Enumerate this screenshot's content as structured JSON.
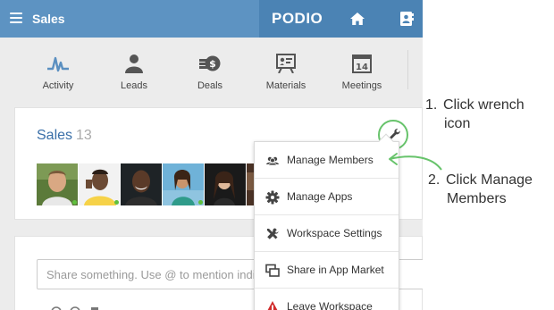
{
  "topbar": {
    "app_title": "Sales",
    "logo": "PODIO",
    "icons": [
      "menu-icon",
      "home-icon",
      "contacts-icon"
    ]
  },
  "nav": {
    "items": [
      {
        "label": "Activity",
        "icon": "activity-icon"
      },
      {
        "label": "Leads",
        "icon": "person-icon"
      },
      {
        "label": "Deals",
        "icon": "money-icon"
      },
      {
        "label": "Materials",
        "icon": "presentation-icon"
      },
      {
        "label": "Meetings",
        "icon": "calendar-icon",
        "icon_text": "14"
      }
    ]
  },
  "workspace": {
    "name": "Sales",
    "member_count": "13"
  },
  "share": {
    "placeholder": "Share something. Use @ to mention indi"
  },
  "menu": {
    "items": [
      {
        "label": "Manage Members",
        "icon": "members-icon"
      },
      {
        "label": "Manage Apps",
        "icon": "gear-icon"
      },
      {
        "label": "Workspace Settings",
        "icon": "tools-icon"
      },
      {
        "label": "Share in App Market",
        "icon": "share-icon"
      },
      {
        "label": "Leave Workspace",
        "icon": "warning-icon"
      }
    ]
  },
  "callouts": {
    "step1_num": "1.",
    "step1_line1": "Click wrench",
    "step1_line2": "icon",
    "step2_num": "2.",
    "step2_line1": "Click Manage",
    "step2_line2": "Members"
  },
  "colors": {
    "topbar": "#5d93c2",
    "brand_zone": "#4b83b4",
    "highlight_green": "#67c36b",
    "link_blue": "#3a6fa8"
  }
}
